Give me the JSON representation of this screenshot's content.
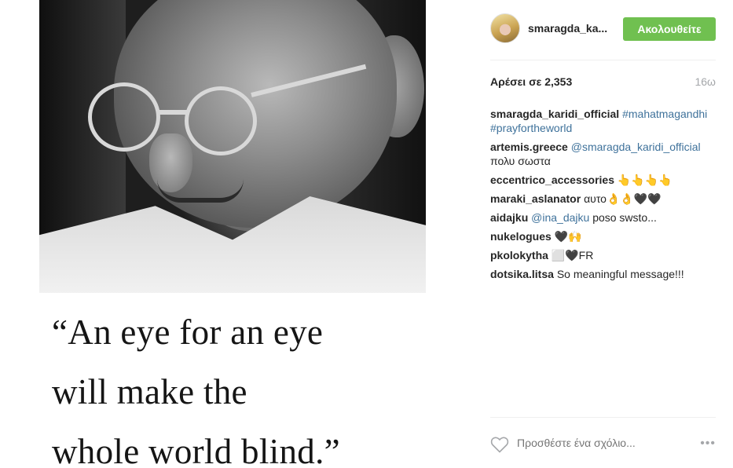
{
  "post": {
    "quote_lines": [
      "“An eye for an eye",
      "will make the",
      "whole world blind.”"
    ]
  },
  "header": {
    "username": "smaragda_ka...",
    "follow_label": "Ακολουθείτε",
    "accent": "#70c050"
  },
  "meta": {
    "likes": "Αρέσει σε 2,353",
    "age": "16ω"
  },
  "comments": [
    {
      "user": "smaragda_karidi_official",
      "parts": [
        {
          "kind": "tag",
          "text": "#mahatmagandhi"
        },
        {
          "kind": "tag",
          "text": "#prayfortheworld"
        }
      ]
    },
    {
      "user": "artemis.greece",
      "parts": [
        {
          "kind": "mention",
          "text": "@smaragda_karidi_official"
        },
        {
          "kind": "text",
          "text": "πολυ σωστα"
        }
      ]
    },
    {
      "user": "eccentrico_accessories",
      "parts": [
        {
          "kind": "text",
          "text": "👆👆👆👆"
        }
      ]
    },
    {
      "user": "maraki_aslanator",
      "parts": [
        {
          "kind": "text",
          "text": "αυτο👌👌🖤🖤"
        }
      ]
    },
    {
      "user": "aidajku",
      "parts": [
        {
          "kind": "mention",
          "text": "@ina_dajku"
        },
        {
          "kind": "text",
          "text": "poso swsto..."
        }
      ]
    },
    {
      "user": "nukelogues",
      "parts": [
        {
          "kind": "text",
          "text": "🖤🙌"
        }
      ]
    },
    {
      "user": "pkolokytha",
      "parts": [
        {
          "kind": "text",
          "text": "⬜🖤FR"
        }
      ]
    },
    {
      "user": "dotsika.litsa",
      "parts": [
        {
          "kind": "text",
          "text": "So meaningful message!!!"
        }
      ]
    }
  ],
  "footer": {
    "like_icon": "heart-outline-icon",
    "comment_placeholder": "Προσθέστε ένα σχόλιο...",
    "more_label": "•••"
  }
}
